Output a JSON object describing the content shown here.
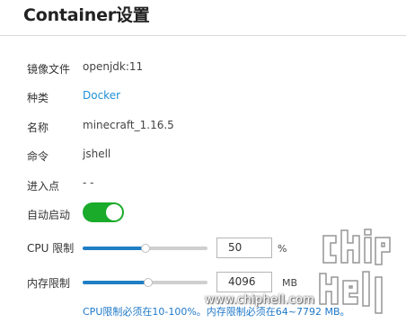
{
  "header": {
    "title": "Container设置"
  },
  "fields": {
    "image": {
      "label": "镜像文件",
      "value": "openjdk:11"
    },
    "type": {
      "label": "种类",
      "value": "Docker"
    },
    "name": {
      "label": "名称",
      "value": "minecraft_1.16.5"
    },
    "command": {
      "label": "命令",
      "value": "jshell"
    },
    "entrypoint": {
      "label": "进入点",
      "value": "- -"
    },
    "autostart": {
      "label": "自动启动",
      "enabled": true
    }
  },
  "cpu_limit": {
    "label": "CPU 限制",
    "value": "50",
    "unit": "%",
    "slider_percent": 50
  },
  "memory_limit": {
    "label": "内存限制",
    "value": "4096",
    "unit": "MB",
    "slider_min": 64,
    "slider_max": 7792
  },
  "hint": "CPU限制必须在10-100%。内存限制必须在64~7792 MB。",
  "watermark": {
    "url": "www.chiphell.com",
    "logo": "chiphell"
  },
  "colors": {
    "accent": "#1f7fc4",
    "toggle_on": "#1aab2b",
    "link": "#1e90d6"
  }
}
